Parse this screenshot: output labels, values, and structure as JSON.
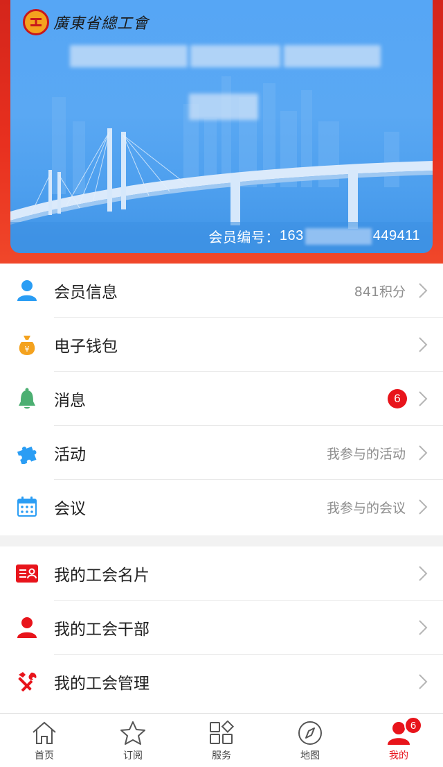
{
  "card": {
    "org_name": "廣東省總工會",
    "member_no_label": "会员编号：",
    "member_no_prefix": "163",
    "member_no_suffix": "449411"
  },
  "menu": {
    "member_info": {
      "label": "会员信息",
      "right": "841积分"
    },
    "wallet": {
      "label": "电子钱包"
    },
    "messages": {
      "label": "消息",
      "badge": "6"
    },
    "activities": {
      "label": "活动",
      "right": "我参与的活动"
    },
    "meetings": {
      "label": "会议",
      "right": "我参与的会议"
    },
    "union_card": {
      "label": "我的工会名片"
    },
    "union_cadre": {
      "label": "我的工会干部"
    },
    "union_manage": {
      "label": "我的工会管理"
    }
  },
  "tabbar": {
    "home": "首页",
    "subscribe": "订阅",
    "services": "服务",
    "map": "地图",
    "mine": "我的",
    "mine_badge": "6"
  },
  "colors": {
    "brand_red": "#e8141b",
    "card_blue": "#56a6f5",
    "accent_blue": "#2a9df4",
    "green": "#4caf72",
    "orange": "#f4a21e"
  },
  "icons": {
    "member_info": "person-icon",
    "wallet": "money-bag-icon",
    "messages": "bell-icon",
    "activities": "puzzle-icon",
    "meetings": "calendar-icon",
    "union_card": "id-card-icon",
    "union_cadre": "person-icon",
    "union_manage": "tools-icon"
  }
}
